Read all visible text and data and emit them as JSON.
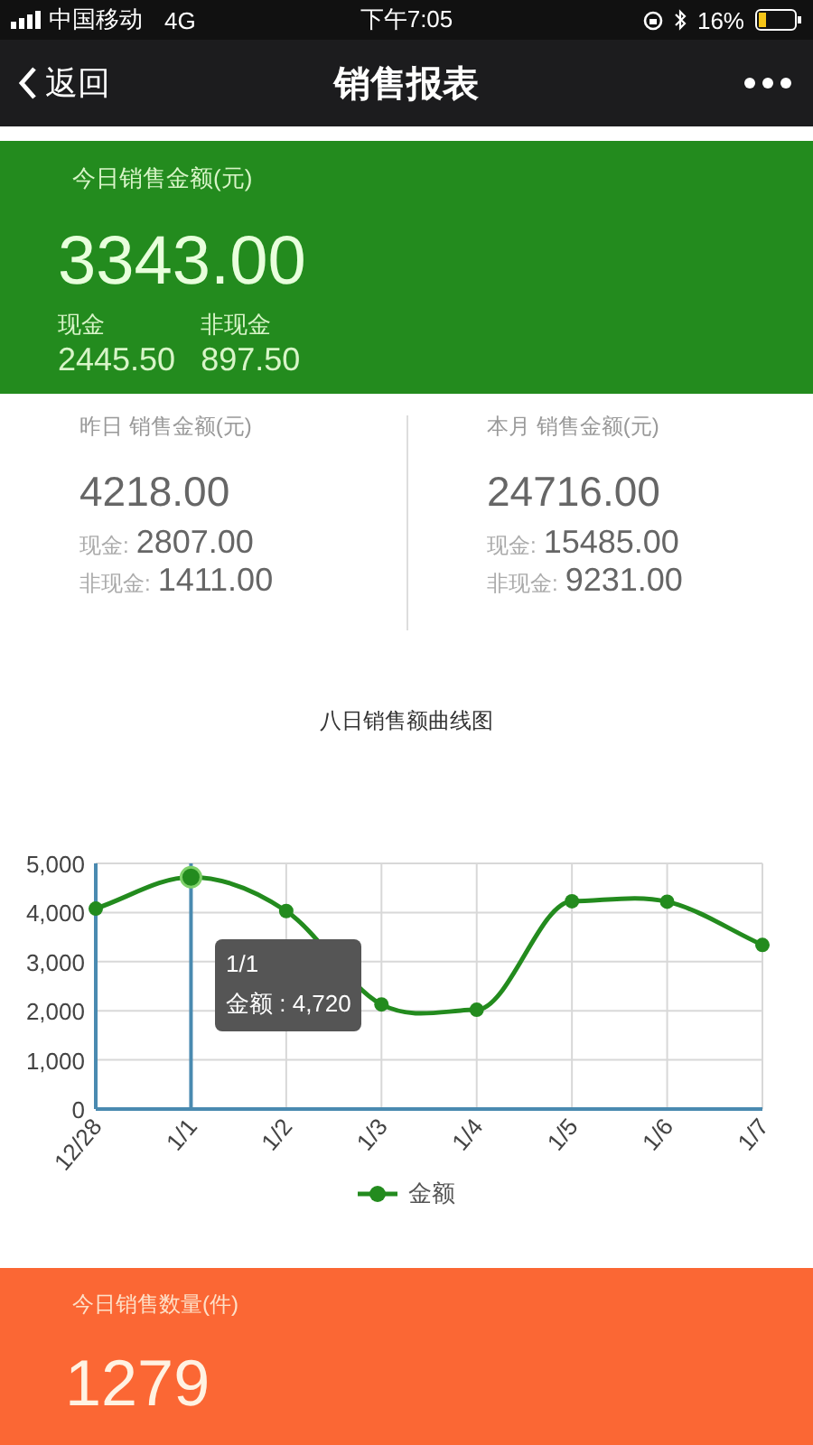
{
  "status_bar": {
    "carrier": "中国移动",
    "network": "4G",
    "time": "下午7:05",
    "battery": "16%"
  },
  "nav": {
    "back_label": "返回",
    "title": "销售报表"
  },
  "today": {
    "label": "今日销售金额(元)",
    "amount": "3343.00",
    "cash_label": "现金",
    "cash": "2445.50",
    "noncash_label": "非现金",
    "noncash": "897.50"
  },
  "periods": [
    {
      "label": "昨日  销售金额(元)",
      "amount": "4218.00",
      "rows": [
        {
          "label": "现金:",
          "value": "2807.00"
        },
        {
          "label": "非现金:",
          "value": "1411.00"
        }
      ]
    },
    {
      "label": "本月  销售金额(元)",
      "amount": "24716.00",
      "rows": [
        {
          "label": "现金:",
          "value": "15485.00"
        },
        {
          "label": "非现金:",
          "value": "9231.00"
        }
      ]
    }
  ],
  "chart": {
    "title": "八日销售额曲线图",
    "highlight": [
      false,
      true,
      false,
      false,
      false,
      false,
      false,
      false
    ],
    "tooltip": {
      "title": "1/1",
      "text": "金额 : 4,720"
    },
    "chart_data": {
      "type": "line",
      "categories": [
        "12/28",
        "1/1",
        "1/2",
        "1/3",
        "1/4",
        "1/5",
        "1/6",
        "1/7"
      ],
      "series": [
        {
          "name": "金额",
          "color": "#238b1e",
          "marker": "circle",
          "values": [
            4080,
            4720,
            4030,
            2130,
            2020,
            4230,
            4220,
            3340
          ]
        }
      ],
      "grid": true,
      "ref_lines": [
        {
          "axis": "x",
          "value": "1/1",
          "color": "#4a8ab0"
        }
      ],
      "ylim": [
        0,
        5000
      ],
      "yticks": [
        {
          "value": 0,
          "label": "0"
        },
        {
          "value": 1000,
          "label": "1,000"
        },
        {
          "value": 2000,
          "label": "2,000"
        },
        {
          "value": 3000,
          "label": "3,000"
        },
        {
          "value": 4000,
          "label": "4,000"
        },
        {
          "value": 5000,
          "label": "5,000"
        }
      ]
    }
  },
  "quantity": {
    "label": "今日销售数量(件)",
    "amount": "1279"
  }
}
